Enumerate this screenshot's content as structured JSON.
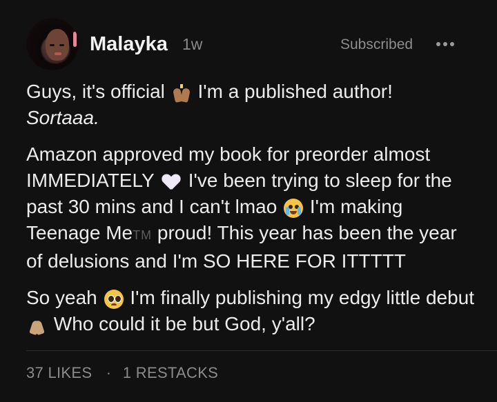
{
  "post": {
    "author": "Malayka",
    "age": "1w",
    "subscribed_label": "Subscribed",
    "more_label": "•••",
    "para1_a": "Guys, it's official",
    "para1_b": "I'm a published author!",
    "para1_c": "Sortaaa.",
    "para2_a": "Amazon approved my book for preorder almost IMMEDIATELY",
    "para2_b": "I've been trying to sleep for the past 30 mins and I can't lmao",
    "para2_c": "I'm making Teenage Me",
    "para2_tm": "TM",
    "para2_d": "proud! This year has been the year of delusions and I'm SO HERE FOR ITTTTT",
    "para3_a": "So yeah",
    "para3_b": "I'm finally publishing my edgy little debut",
    "para3_c": "Who could it be but God, y'all?"
  },
  "footer": {
    "likes": "37 LIKES",
    "separator": "·",
    "restacks": "1 RESTACKS"
  },
  "icons": {
    "praise": "raising-hands-icon",
    "heart": "white-heart-icon",
    "cry": "crying-face-icon",
    "pleading": "pleading-face-icon",
    "pray": "folded-hands-icon"
  }
}
